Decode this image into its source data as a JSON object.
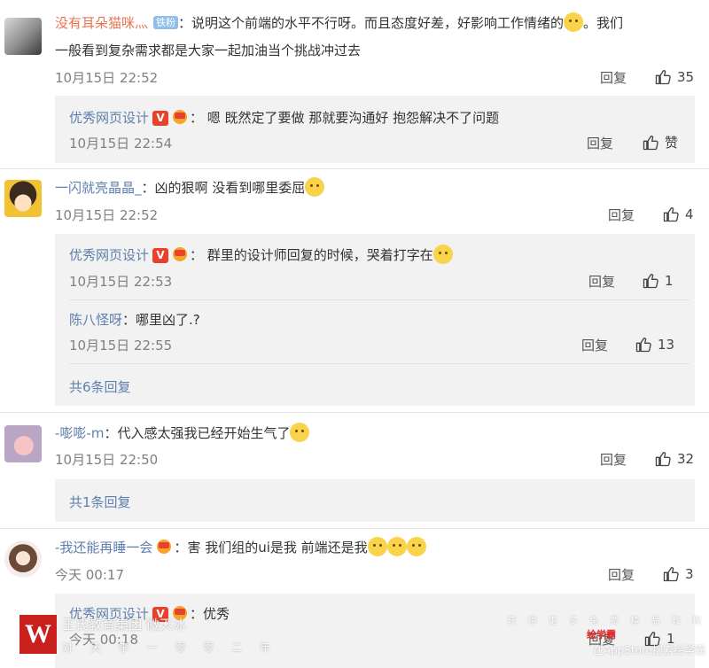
{
  "colors": {
    "name_orange": "#eb7350",
    "name_blue": "#5e7fad",
    "date_gray": "#808080",
    "subbox_bg": "#f2f2f2",
    "vip_red": "#e8412c"
  },
  "icons": {
    "like": "thumbs-up-icon",
    "vip": "vip-v-icon",
    "fist": "fist-icon",
    "emoji": "emoji-icon"
  },
  "reply_label": "回复",
  "comments": [
    {
      "name": "没有耳朵猫咪灬",
      "badge": "铁粉",
      "text_line1": "：说明这个前端的水平不行呀。而且态度好差，好影响工作情绪的",
      "text_line1_tail": "。我们",
      "text_line2": "一般看到复杂需求都是大家一起加油当个挑战冲过去",
      "date": "10月15日 22:52",
      "likes": "35",
      "replies": [
        {
          "name": "优秀网页设计",
          "text": "：  嗯  既然定了要做    那就要沟通好    抱怨解决不了问题",
          "date": "10月15日 22:54",
          "likes": "赞"
        }
      ]
    },
    {
      "name": "一闪就亮晶晶_",
      "text": "：凶的狠啊 没看到哪里委屈",
      "date": "10月15日 22:52",
      "likes": "4",
      "replies": [
        {
          "name": "优秀网页设计",
          "text": "：  群里的设计师回复的时候，哭着打字在",
          "date": "10月15日 22:53",
          "likes": "1"
        },
        {
          "name": "陈八怪呀",
          "text": "：哪里凶了.?",
          "date": "10月15日 22:55",
          "likes": "13"
        }
      ],
      "more_replies": "共6条回复"
    },
    {
      "name": "-嘭嘭-m",
      "text": "：代入感太强我已经开始生气了",
      "date": "10月15日 22:50",
      "likes": "32",
      "more_replies": "共1条回复"
    },
    {
      "name": "-我还能再睡一会",
      "text": "：害  我们组的ui是我 前端还是我",
      "date": "今天 00:17",
      "likes": "3",
      "replies": [
        {
          "name": "优秀网页设计",
          "text": "：优秀",
          "date": "今天 00:18",
          "likes": "1"
        }
      ]
    }
  ],
  "watermark": {
    "logo": "W",
    "title": "王氏教育集团  微天冰",
    "subtitle": "对 天 李 一 零 零 二 年",
    "right_line1": "获 得 更 多 免 费 精 品 教 程",
    "right_line2": "绘学霸",
    "right_line3": "在AppStore搜索绘学霸"
  }
}
